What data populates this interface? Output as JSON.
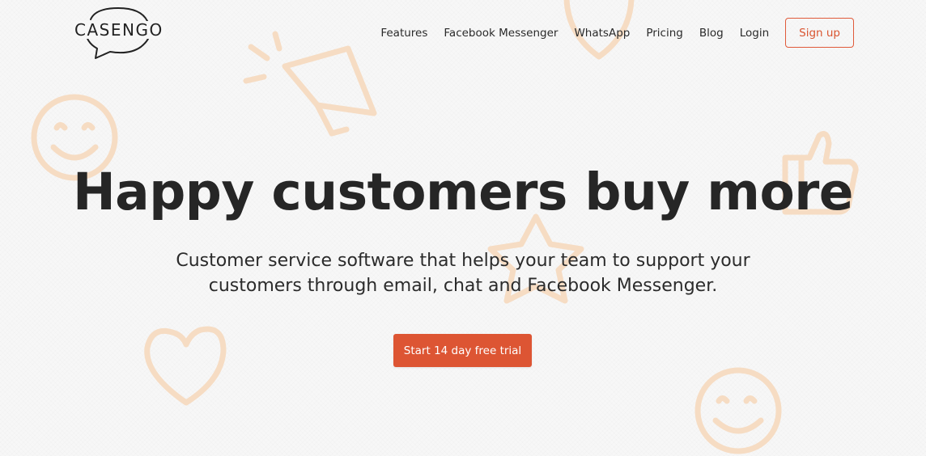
{
  "brand": {
    "logo_text": "CASENGO"
  },
  "nav": {
    "links": [
      "Features",
      "Facebook Messenger",
      "WhatsApp",
      "Pricing",
      "Blog",
      "Login"
    ],
    "signup_label": "Sign up"
  },
  "hero": {
    "title": "Happy customers buy more",
    "subtitle_line1": "Customer service software that helps your team to support your",
    "subtitle_line2": "customers through email, chat and Facebook Messenger.",
    "cta_label": "Start 14 day free trial"
  },
  "colors": {
    "accent": "#dd5533",
    "text": "#222222",
    "background": "#f7f7f7",
    "decoration": "#f6dcc3"
  },
  "icons": {
    "logo": "speech-bubble-icon",
    "decorations": [
      "smiley-icon",
      "megaphone-icon",
      "heart-icon",
      "star-icon",
      "thumbs-up-icon"
    ]
  }
}
